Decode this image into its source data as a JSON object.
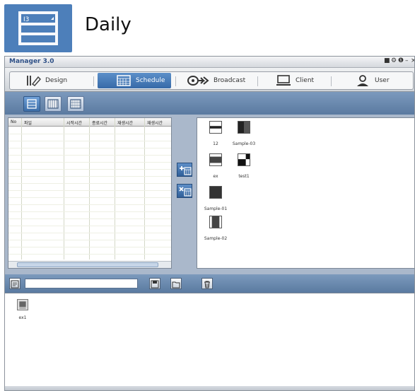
{
  "header": {
    "title": "Daily",
    "icon": "daily-layout-icon",
    "accent": "#4d7fba"
  },
  "window": {
    "title": "Manager 3.0",
    "controls": [
      "■",
      "⚙",
      "❶",
      "–",
      "×"
    ]
  },
  "menu": {
    "items": [
      {
        "label": "Design",
        "icon": "design-icon"
      },
      {
        "label": "Schedule",
        "icon": "calendar-icon"
      },
      {
        "label": "Broadcast",
        "icon": "broadcast-icon"
      },
      {
        "label": "Client",
        "icon": "monitor-icon"
      },
      {
        "label": "User",
        "icon": "user-icon"
      }
    ],
    "active": "Schedule"
  },
  "view_tabs": [
    {
      "name": "daily-view",
      "selected": true
    },
    {
      "name": "weekly-view",
      "selected": false
    },
    {
      "name": "monthly-view",
      "selected": false
    }
  ],
  "schedule_table": {
    "columns": [
      "No",
      "파일",
      "시작시간",
      "종료시간",
      "재생시간",
      "재생시간"
    ]
  },
  "content_items": [
    "12",
    "Sample-03",
    "ex",
    "test1",
    "Sample-01",
    "Sample-02"
  ],
  "bottom_toolbar": {
    "name_value": ""
  },
  "file_list": [
    {
      "label": "ex1"
    }
  ]
}
